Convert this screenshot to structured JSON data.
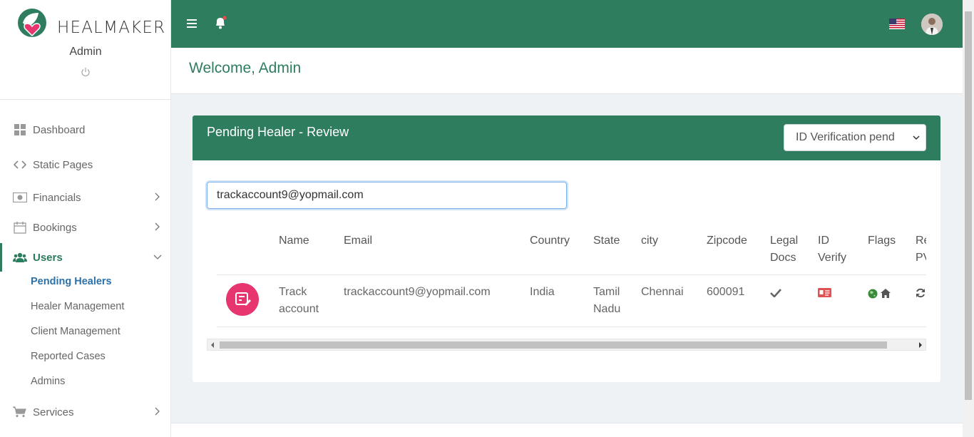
{
  "brand": {
    "name": "HEALMAKER",
    "role": "Admin"
  },
  "colors": {
    "primary": "#2f7d5f",
    "accent": "#e6356f",
    "link": "#2b71a8"
  },
  "sidebar": {
    "items": [
      {
        "label": "Dashboard",
        "icon": "dashboard-icon"
      },
      {
        "label": "Static Pages",
        "icon": "code-icon"
      },
      {
        "label": "Financials",
        "icon": "money-icon"
      },
      {
        "label": "Bookings",
        "icon": "calendar-icon"
      },
      {
        "label": "Users",
        "icon": "users-icon"
      },
      {
        "label": "Services",
        "icon": "cart-icon"
      }
    ],
    "users_sub": [
      "Pending Healers",
      "Healer Management",
      "Client Management",
      "Reported Cases",
      "Admins"
    ]
  },
  "welcome": {
    "title": "Welcome, Admin"
  },
  "card": {
    "title": "Pending Healer - Review",
    "filter_value": "ID Verification pend",
    "search_value": "trackaccount9@yopmail.com"
  },
  "table": {
    "headers": {
      "name": "Name",
      "email": "Email",
      "country": "Country",
      "state": "State",
      "city": "city",
      "zipcode": "Zipcode",
      "legal_1": "Legal",
      "legal_2": "Docs",
      "id_1": "ID",
      "id_2": "Verify",
      "flags": "Flags",
      "re_1": "Re",
      "re_2": "PV"
    },
    "row": {
      "name_1": "Track",
      "name_2": "account",
      "email": "trackaccount9@yopmail.com",
      "country": "India",
      "state_1": "Tamil",
      "state_2": "Nadu",
      "city": "Chennai",
      "zipcode": "600091"
    }
  }
}
